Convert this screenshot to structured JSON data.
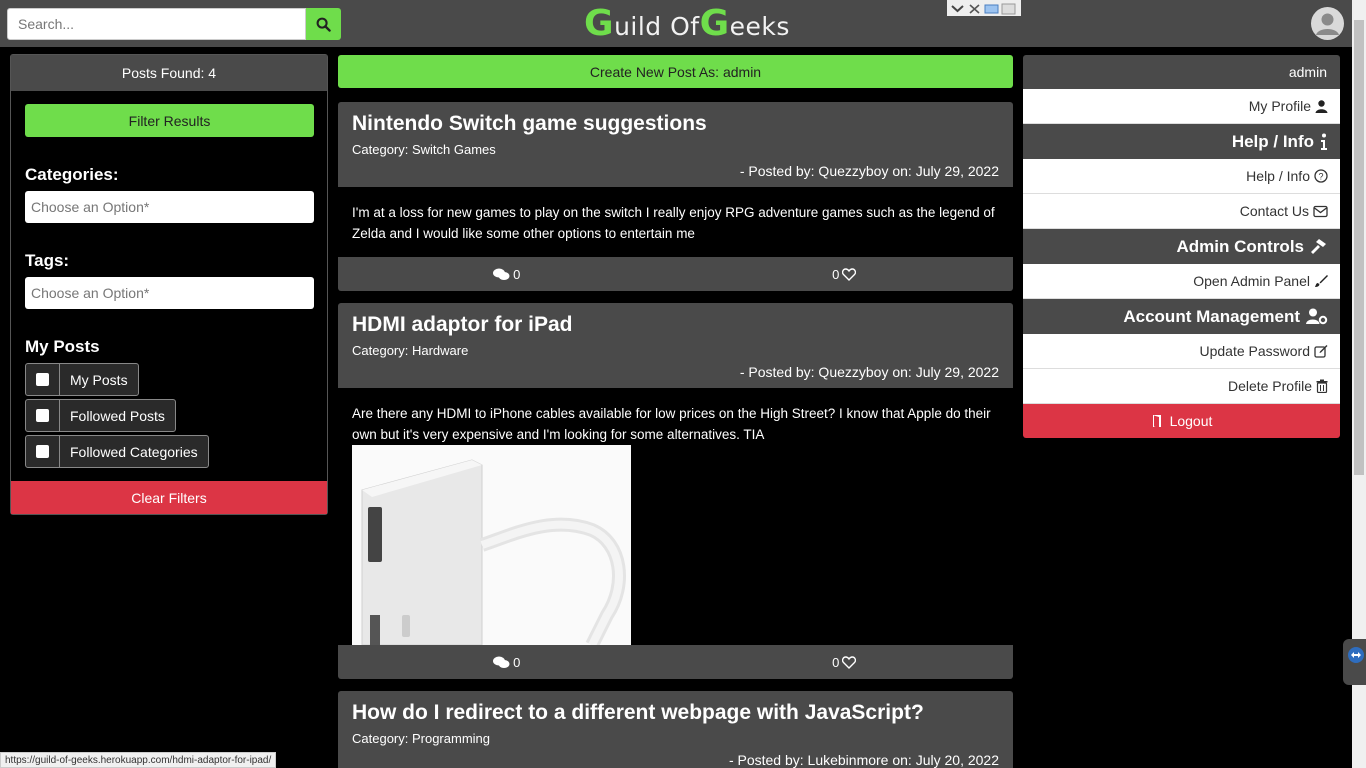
{
  "header": {
    "search_placeholder": "Search...",
    "logo_cap1": "G",
    "logo_rest1": "uild Of ",
    "logo_cap2": "G",
    "logo_rest2": "eeks"
  },
  "left": {
    "posts_found": "Posts Found: 4",
    "filter_button": "Filter Results",
    "categories_label": "Categories:",
    "categories_placeholder": "Choose an Option*",
    "tags_label": "Tags:",
    "tags_placeholder": "Choose an Option*",
    "my_posts_label": "My Posts",
    "checks": [
      "My Posts",
      "Followed Posts",
      "Followed Categories"
    ],
    "clear_button": "Clear Filters"
  },
  "center": {
    "create_button": "Create New Post As: admin",
    "posts": [
      {
        "title": "Nintendo Switch game suggestions",
        "category": "Category: Switch Games",
        "posted_by": "- Posted by: Quezzyboy on: July 29, 2022",
        "body": "I'm at a loss for new games to play on the switch I really enjoy RPG adventure games such as the legend of Zelda and I would like some other options to entertain me",
        "comments": "0",
        "likes": "0"
      },
      {
        "title": "HDMI adaptor for iPad",
        "category": "Category: Hardware",
        "posted_by": "- Posted by: Quezzyboy on: July 29, 2022",
        "body": "Are there any HDMI to iPhone cables available for low prices on the High Street? I know that Apple do their own but it's very expensive and I'm looking for some alternatives. TIA",
        "comments": "0",
        "likes": "0"
      },
      {
        "title": "How do I redirect to a different webpage with JavaScript?",
        "category": "Category: Programming",
        "posted_by": "- Posted by: Lukebinmore on: July 20, 2022"
      }
    ]
  },
  "right": {
    "username": "admin",
    "my_profile": "My Profile",
    "help_section": "Help / Info",
    "help_info": "Help / Info",
    "contact_us": "Contact Us",
    "admin_section": "Admin Controls",
    "open_admin": "Open Admin Panel",
    "account_section": "Account Management",
    "update_password": "Update Password",
    "delete_profile": "Delete Profile",
    "logout": "Logout"
  },
  "status_bar": "https://guild-of-geeks.herokuapp.com/hdmi-adaptor-for-ipad/",
  "colors": {
    "accent": "#6fdd4b",
    "danger": "#dc3545",
    "panel": "#4a4a4a"
  }
}
